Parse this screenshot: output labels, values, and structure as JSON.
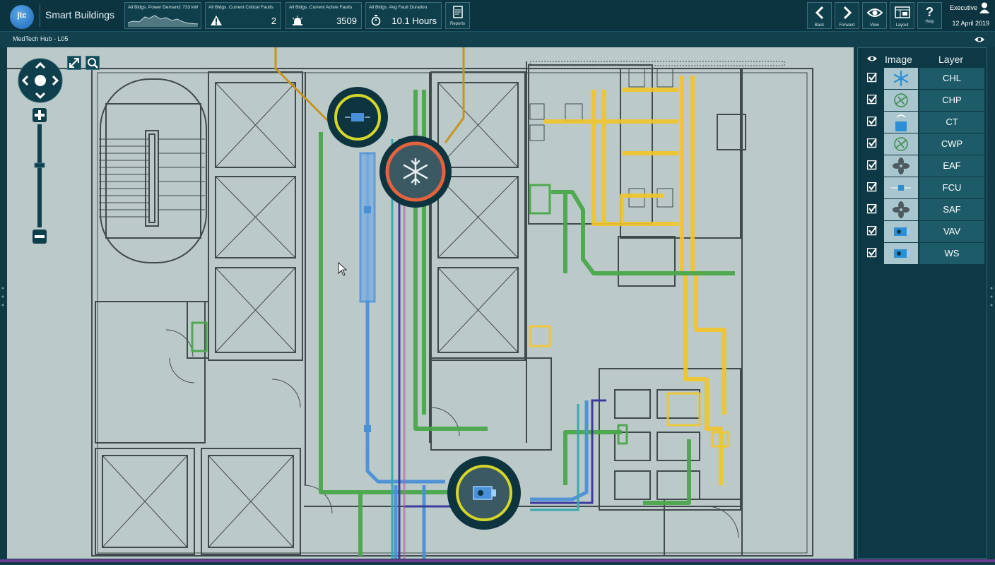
{
  "app": {
    "logo_text": "jtc",
    "title": "Smart Buildings"
  },
  "kpis": [
    {
      "title": "All Bldgs. Power Demand: 733 kW",
      "value": "",
      "icon": "sparkline-chart"
    },
    {
      "title": "All Bldgs. Current Critical Faults",
      "value": "2",
      "icon": "warning-icon"
    },
    {
      "title": "All Bldgs. Current Active Faults",
      "value": "3509",
      "icon": "alarm-light-icon"
    },
    {
      "title": "All Bldgs. Avg Fault Duration",
      "value": "10.1 Hours",
      "icon": "stopwatch-icon"
    }
  ],
  "toolbar": {
    "reports": "Reports",
    "back": "Back",
    "forward": "Forward",
    "view": "View",
    "layout": "Layout",
    "help": "Help",
    "help_glyph": "?"
  },
  "user": {
    "role": "Executive",
    "date": "12 April 2019"
  },
  "subheader": {
    "title": "MedTech Hub - L05"
  },
  "layers_panel": {
    "col_image": "Image",
    "col_layer": "Layer",
    "layers": [
      {
        "name": "CHL",
        "icon": "snowflake-icon",
        "checked": true
      },
      {
        "name": "CHP",
        "icon": "pump-icon",
        "checked": true
      },
      {
        "name": "CT",
        "icon": "cooling-tower-icon",
        "checked": true
      },
      {
        "name": "CWP",
        "icon": "pump-icon",
        "checked": true
      },
      {
        "name": "EAF",
        "icon": "fan-icon",
        "checked": true
      },
      {
        "name": "FCU",
        "icon": "fan-coil-icon",
        "checked": true
      },
      {
        "name": "SAF",
        "icon": "fan-icon",
        "checked": true
      },
      {
        "name": "VAV",
        "icon": "vav-box-icon",
        "checked": true
      },
      {
        "name": "WS",
        "icon": "vav-box-icon",
        "checked": true
      }
    ]
  },
  "colors": {
    "background": "#0f3a46",
    "map": "#bcc9c9",
    "pipe_green": "#4aa84a",
    "pipe_yellow": "#f2c52a",
    "pipe_blue": "#4a90d9",
    "pipe_purple": "#3b3aa0",
    "pipe_orange": "#c79420",
    "ring_yellow": "#d4d62a",
    "ring_red": "#e2633e"
  }
}
